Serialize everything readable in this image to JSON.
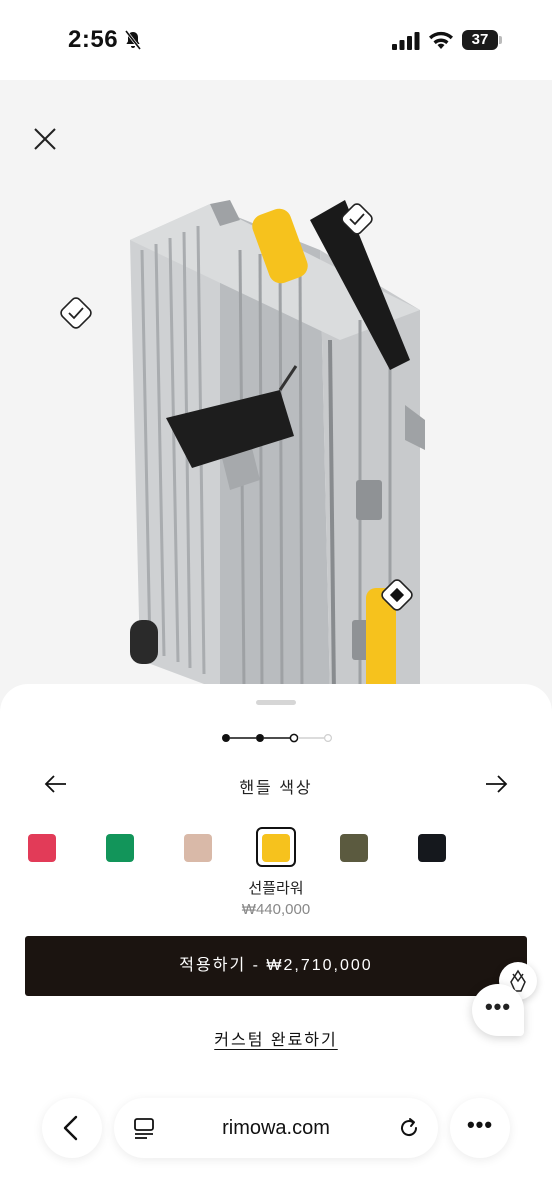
{
  "status_bar": {
    "time": "2:56",
    "battery": "37"
  },
  "stage": {
    "product_image": "aluminium-suitcase-with-yellow-handles"
  },
  "configurator": {
    "steps": [
      {
        "state": "done"
      },
      {
        "state": "done"
      },
      {
        "state": "current"
      },
      {
        "state": "pending"
      }
    ],
    "option_title": "핸들 색상",
    "swatches": [
      {
        "color": "#e23b58",
        "selected": false
      },
      {
        "color": "#12955a",
        "selected": false
      },
      {
        "color": "#d9b9a8",
        "selected": false
      },
      {
        "color": "#f6c21d",
        "selected": true
      },
      {
        "color": "#5b5a3f",
        "selected": false
      },
      {
        "color": "#15181d",
        "selected": false
      }
    ],
    "selected_color_name": "선플라워",
    "selected_color_price": "₩440,000",
    "apply_label": "적용하기 - ₩2,710,000",
    "finish_label": "커스텀 완료하기"
  },
  "browser": {
    "domain": "rimowa.com"
  },
  "colors": {
    "accent_dark": "#1b1410",
    "handle_yellow": "#f6c21d"
  }
}
